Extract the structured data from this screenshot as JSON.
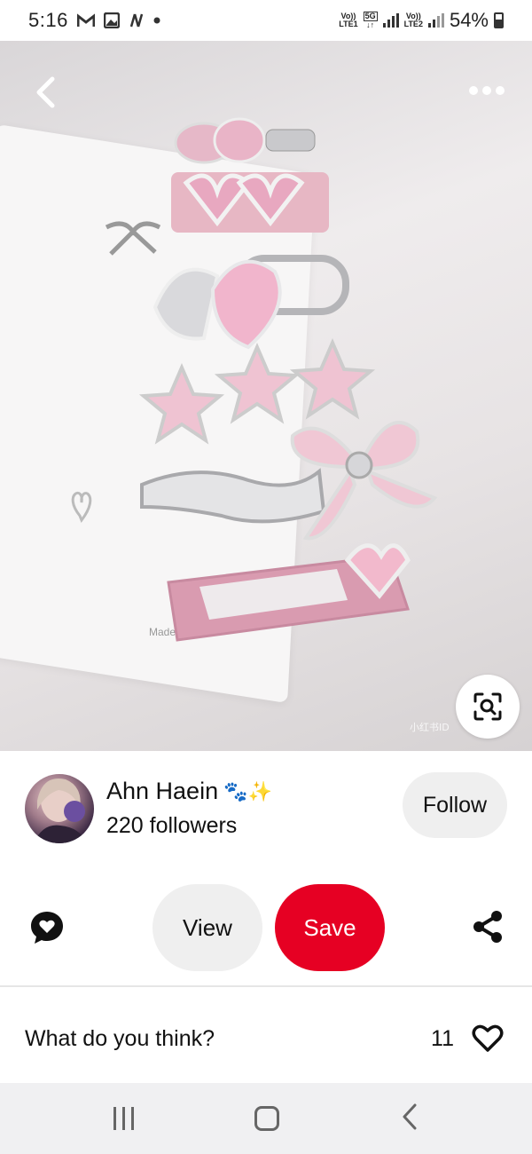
{
  "status_bar": {
    "time": "5:16",
    "notif_icons": [
      "gmail-icon",
      "gallery-icon",
      "n-app-icon",
      "dot-icon"
    ],
    "sim1_top": "Vo))",
    "sim1_bottom": "LTE1",
    "network": "5G",
    "sim2_top": "Vo))",
    "sim2_bottom": "LTE2",
    "battery": "54%"
  },
  "pin": {
    "image_subject": "pink heart, star and bow hair clips on a card",
    "card_text": "Made in",
    "watermark": "小红书ID"
  },
  "author": {
    "name": "Ahn Haein",
    "emoji": "🐾✨",
    "followers": "220 followers",
    "follow_label": "Follow"
  },
  "actions": {
    "view_label": "View",
    "save_label": "Save"
  },
  "comments": {
    "prompt": "What do you think?",
    "reaction_count": "11"
  },
  "colors": {
    "save_red": "#e60023",
    "pill_gray": "#efefef"
  }
}
